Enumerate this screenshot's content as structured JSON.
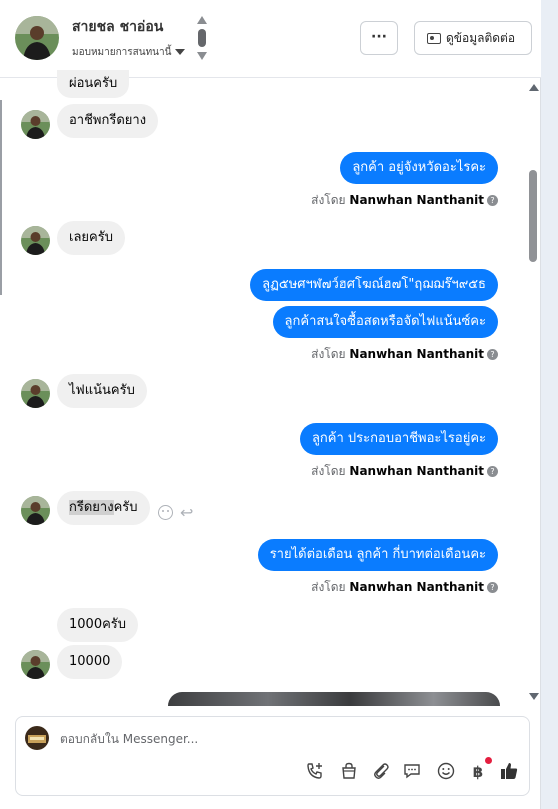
{
  "header": {
    "contact_name": "สายชล ชาอ่อน",
    "assign_label": "มอบหมายการสนทนานี้",
    "more_label": "···",
    "contact_info_button": "ดูข้อมูลติดต่อ"
  },
  "messages": [
    {
      "type": "in",
      "text": "ผ่อนครับ"
    },
    {
      "type": "in",
      "text": "อาชีพกรีดยาง"
    },
    {
      "type": "out",
      "text": "ลูกค้า อยู่จังหวัดอะไรคะ"
    },
    {
      "type": "sentby",
      "prefix": "ส่งโดย",
      "name": "Nanwhan Nanthanit"
    },
    {
      "type": "in",
      "text": "เลยครับ"
    },
    {
      "type": "out",
      "text": "ลูฏ๕ษศฯฬ๗ว์ฮศโฆณ์ฮ๗โ\"ฤฌฌร๊ฯ๙๕ธ"
    },
    {
      "type": "out",
      "text": "ลูกค้าสนใจซื้อสดหรือจัดไฟแน้นซ์คะ"
    },
    {
      "type": "sentby",
      "prefix": "ส่งโดย",
      "name": "Nanwhan Nanthanit"
    },
    {
      "type": "in",
      "text": "ไฟแน้นครับ"
    },
    {
      "type": "out",
      "text": "ลูกค้า ประกอบอาชีพอะไรอยู่คะ"
    },
    {
      "type": "sentby",
      "prefix": "ส่งโดย",
      "name": "Nanwhan Nanthanit"
    },
    {
      "type": "in",
      "text_highlight": "กรีดยาง",
      "text_rest": "ครับ"
    },
    {
      "type": "out",
      "text": "รายได้ต่อเดือน ลูกค้า กี่บาทต่อเดือนคะ"
    },
    {
      "type": "sentby",
      "prefix": "ส่งโดย",
      "name": "Nanwhan Nanthanit"
    },
    {
      "type": "in",
      "text": "1000ครับ"
    },
    {
      "type": "in",
      "text": "10000"
    }
  ],
  "composer": {
    "placeholder": "ตอบกลับใน Messenger...",
    "tools": [
      "phone-plus-icon",
      "shopping-bag-icon",
      "paperclip-icon",
      "chat-bubbles-icon",
      "emoji-icon",
      "baht-icon",
      "thumbs-up-icon"
    ]
  },
  "colors": {
    "outgoing_bubble": "#0a7cff",
    "incoming_bubble": "#f0f0f0",
    "notification_dot": "#e41e3f"
  }
}
